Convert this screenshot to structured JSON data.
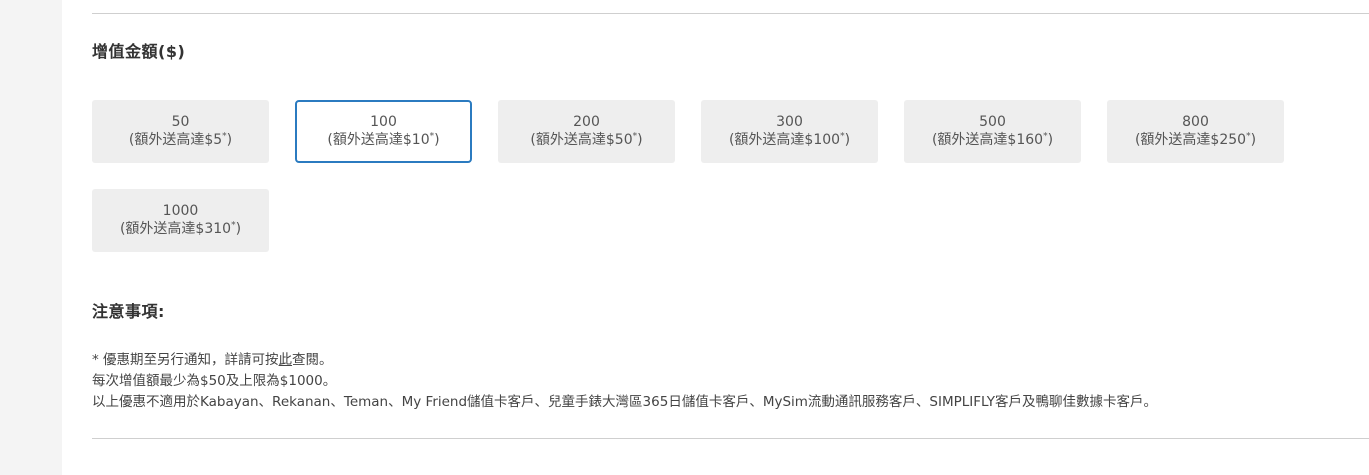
{
  "section_title": "增值金額($)",
  "amount_options": [
    {
      "value": "50",
      "bonus_prefix": "(額外送高達$5",
      "bonus_mark": "*",
      "bonus_suffix": ")",
      "selected": false
    },
    {
      "value": "100",
      "bonus_prefix": "(額外送高達$10",
      "bonus_mark": "*",
      "bonus_suffix": ")",
      "selected": true
    },
    {
      "value": "200",
      "bonus_prefix": "(額外送高達$50",
      "bonus_mark": "*",
      "bonus_suffix": ")",
      "selected": false
    },
    {
      "value": "300",
      "bonus_prefix": "(額外送高達$100",
      "bonus_mark": "*",
      "bonus_suffix": ")",
      "selected": false
    },
    {
      "value": "500",
      "bonus_prefix": "(額外送高達$160",
      "bonus_mark": "*",
      "bonus_suffix": ")",
      "selected": false
    },
    {
      "value": "800",
      "bonus_prefix": "(額外送高達$250",
      "bonus_mark": "*",
      "bonus_suffix": ")",
      "selected": false
    },
    {
      "value": "1000",
      "bonus_prefix": "(額外送高達$310",
      "bonus_mark": "*",
      "bonus_suffix": ")",
      "selected": false
    }
  ],
  "notes": {
    "title": "注意事項:",
    "line1_prefix": "* 優惠期至另行通知，詳請可按",
    "line1_link": "此",
    "line1_suffix": "查閱。",
    "line2": "每次增值額最少為$50及上限為$1000。",
    "line3": "以上優惠不適用於Kabayan、Rekanan、Teman、My Friend儲值卡客戶、兒童手錶大灣區365日儲值卡客戶、MySim流動通訊服務客戶、SIMPLIFLY客戶及鴨聊佳數據卡客戶。"
  },
  "colors": {
    "selected_border": "#2b7bc0",
    "option_background": "#eeeeee"
  }
}
